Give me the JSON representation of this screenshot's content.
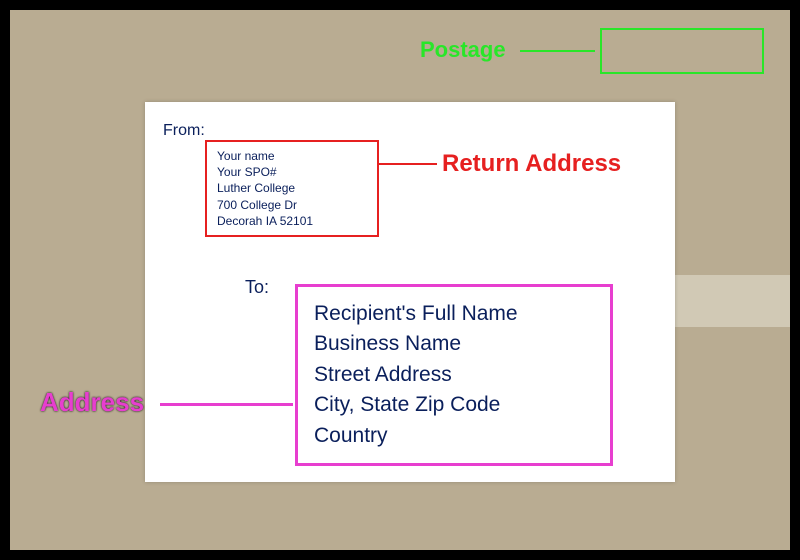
{
  "postage": {
    "label": "Postage"
  },
  "return_address": {
    "heading": "From:",
    "callout": "Return Address",
    "lines": {
      "l1": "Your name",
      "l2": "Your SPO#",
      "l3": "Luther College",
      "l4": "700 College Dr",
      "l5": "Decorah IA  52101"
    }
  },
  "destination": {
    "heading": "To:",
    "callout": "Address",
    "lines": {
      "l1": "Recipient's Full Name",
      "l2": "Business Name",
      "l3": "Street Address",
      "l4": "City, State  Zip Code",
      "l5": "Country"
    }
  }
}
